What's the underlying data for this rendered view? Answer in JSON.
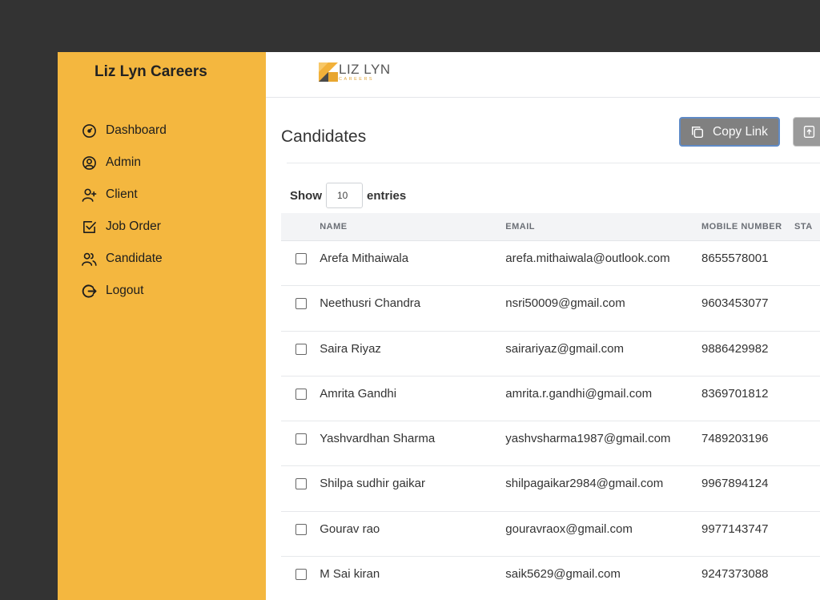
{
  "sidebar": {
    "brand": "Liz Lyn Careers",
    "items": [
      {
        "label": "Dashboard",
        "icon": "dashboard-icon"
      },
      {
        "label": "Admin",
        "icon": "user-circle-icon"
      },
      {
        "label": "Client",
        "icon": "user-plus-icon"
      },
      {
        "label": "Job Order",
        "icon": "checkbox-icon"
      },
      {
        "label": "Candidate",
        "icon": "users-icon"
      },
      {
        "label": "Logout",
        "icon": "logout-icon"
      }
    ]
  },
  "header": {
    "logo_name": "LIZ LYN",
    "logo_sub": "CAREERS"
  },
  "page": {
    "title": "Candidates",
    "copy_link_label": "Copy Link"
  },
  "entries": {
    "show_label": "Show",
    "value": "10",
    "entries_label": "entries"
  },
  "table": {
    "columns": [
      "NAME",
      "EMAIL",
      "MOBILE NUMBER",
      "STA"
    ],
    "rows": [
      {
        "name": "Arefa Mithaiwala",
        "email": "arefa.mithaiwala@outlook.com",
        "mobile": "8655578001"
      },
      {
        "name": "Neethusri Chandra",
        "email": "nsri50009@gmail.com",
        "mobile": "9603453077"
      },
      {
        "name": "Saira Riyaz",
        "email": "sairariyaz@gmail.com",
        "mobile": "9886429982"
      },
      {
        "name": "Amrita Gandhi",
        "email": "amrita.r.gandhi@gmail.com",
        "mobile": "8369701812"
      },
      {
        "name": "Yashvardhan Sharma",
        "email": "yashvsharma1987@gmail.com",
        "mobile": "7489203196"
      },
      {
        "name": "Shilpa sudhir gaikar",
        "email": "shilpagaikar2984@gmail.com",
        "mobile": "9967894124"
      },
      {
        "name": "Gourav rao",
        "email": "gouravraox@gmail.com",
        "mobile": "9977143747"
      },
      {
        "name": "M Sai kiran",
        "email": "saik5629@gmail.com",
        "mobile": "9247373088"
      }
    ]
  },
  "colors": {
    "sidebar_bg": "#f4b73f",
    "backdrop": "#333333",
    "copy_button_bg": "#808080",
    "copy_button_border": "#5f8ac6"
  }
}
